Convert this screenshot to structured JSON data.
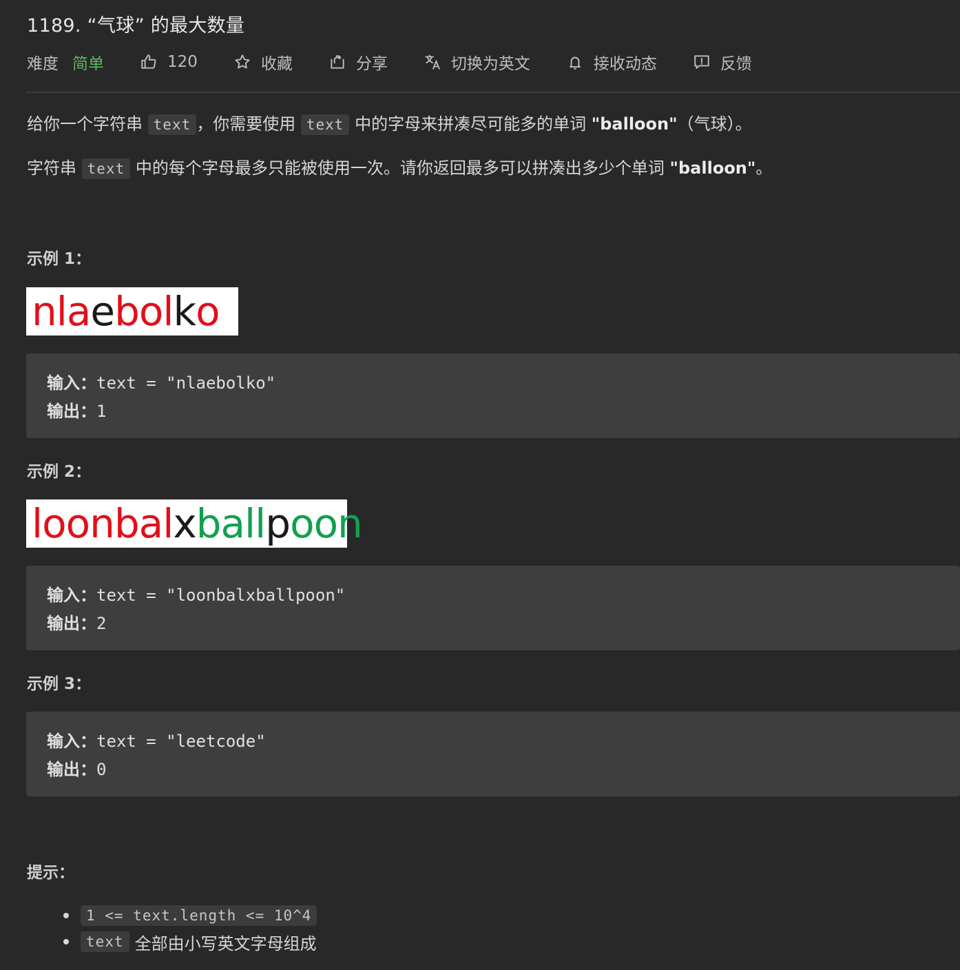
{
  "title": "1189. “气球” 的最大数量",
  "meta": {
    "difficulty_label": "难度",
    "difficulty_value": "简单",
    "likes": "120",
    "favorite": "收藏",
    "share": "分享",
    "translate": "切换为英文",
    "subscribe": "接收动态",
    "feedback": "反馈",
    "difficulty_color": "#5cb85c"
  },
  "desc": {
    "p1_a": "给你一个字符串",
    "p1_code1": "text",
    "p1_b": "，你需要使用",
    "p1_code2": "text",
    "p1_c": "中的字母来拼凑尽可能多的单词",
    "p1_bold": "\"balloon\"",
    "p1_d": "（气球）。",
    "p2_a": "字符串",
    "p2_code": "text",
    "p2_b": "中的每个字母最多只能被使用一次。请你返回最多可以拼凑出多少个单词",
    "p2_bold": "\"balloon\"",
    "p2_c": "。"
  },
  "examples": [
    {
      "heading": "示例 1：",
      "image_segments": [
        {
          "t": "nla",
          "c": "red"
        },
        {
          "t": "e",
          "c": "blk"
        },
        {
          "t": "bol",
          "c": "red"
        },
        {
          "t": "k",
          "c": "blk"
        },
        {
          "t": "o",
          "c": "red"
        }
      ],
      "input_label": "输入：",
      "input": "text = \"nlaebolko\"",
      "output_label": "输出：",
      "output": "1"
    },
    {
      "heading": "示例 2：",
      "image_segments": [
        {
          "t": "loonbal",
          "c": "red"
        },
        {
          "t": "x",
          "c": "blk"
        },
        {
          "t": "ball",
          "c": "grn"
        },
        {
          "t": "p",
          "c": "blk"
        },
        {
          "t": "oon",
          "c": "grn"
        }
      ],
      "input_label": "输入：",
      "input": "text = \"loonbalxballpoon\"",
      "output_label": "输出：",
      "output": "2"
    },
    {
      "heading": "示例 3：",
      "input_label": "输入：",
      "input": "text = \"leetcode\"",
      "output_label": "输出：",
      "output": "0"
    }
  ],
  "hints": {
    "heading": "提示：",
    "item1_code": "1 <= text.length <= 10^4",
    "item2_code": "text",
    "item2_text": "全部由小写英文字母组成"
  },
  "icons": [
    "thumbs-up-icon",
    "star-icon",
    "share-icon",
    "translate-icon",
    "bell-icon",
    "feedback-icon"
  ]
}
